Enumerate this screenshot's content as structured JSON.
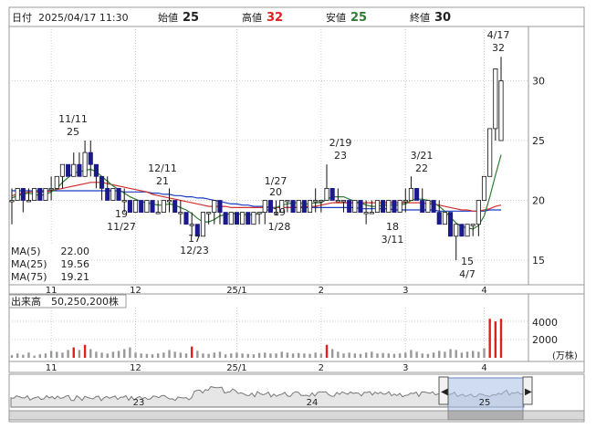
{
  "header": {
    "date_label": "日付",
    "datetime": "2025/04/17 11:30",
    "open_label": "始値",
    "open": "25",
    "high_label": "高値",
    "high": "32",
    "low_label": "安値",
    "low": "25",
    "close_label": "終値",
    "close": "30"
  },
  "legend": {
    "ma5_label": "MA(5)",
    "ma5_value": "22.00",
    "ma5_color": "#2e7d32",
    "ma25_label": "MA(25)",
    "ma25_value": "19.56",
    "ma25_color": "#d32f2f",
    "ma75_label": "MA(75)",
    "ma75_value": "19.21",
    "ma75_color": "#1a3dc8"
  },
  "volume": {
    "label": "出来高",
    "value": "50,250,200株",
    "ticks": [
      "4000",
      "2000"
    ],
    "unit": "(万株)"
  },
  "xaxis_months": [
    "11",
    "12",
    "25/1",
    "2",
    "3",
    "4"
  ],
  "navigator": {
    "year_labels": [
      "23",
      "24",
      "25"
    ]
  },
  "colors": {
    "up": "#ffffff",
    "down": "#1a1a8c",
    "vol_up": "#e02020",
    "vol_down": "#999999"
  },
  "chart_data": {
    "type": "candlestick",
    "y_ticks": [
      15,
      20,
      25,
      30
    ],
    "ylim": [
      12,
      35
    ],
    "annotations": [
      {
        "date": "11/11",
        "value": "25"
      },
      {
        "date": "11/27",
        "value": "19"
      },
      {
        "date": "12/11",
        "value": "21"
      },
      {
        "date": "12/23",
        "value": "17"
      },
      {
        "date": "1/27",
        "value": "20"
      },
      {
        "date": "1/28",
        "value": "19"
      },
      {
        "date": "2/19",
        "value": "23"
      },
      {
        "date": "3/11",
        "value": "18"
      },
      {
        "date": "3/21",
        "value": "22"
      },
      {
        "date": "4/7",
        "value": "15"
      },
      {
        "date": "4/17",
        "value": "32"
      }
    ],
    "candles": [
      [
        20,
        21,
        18,
        20
      ],
      [
        20,
        21,
        20,
        21
      ],
      [
        21,
        21,
        19,
        20
      ],
      [
        20,
        21,
        20,
        20
      ],
      [
        20,
        21,
        20,
        21
      ],
      [
        21,
        21,
        20,
        20
      ],
      [
        20,
        21,
        20,
        21
      ],
      [
        21,
        22,
        20,
        21
      ],
      [
        21,
        22,
        21,
        22
      ],
      [
        22,
        23,
        21,
        23
      ],
      [
        23,
        23,
        22,
        22
      ],
      [
        22,
        24,
        22,
        23
      ],
      [
        23,
        24,
        22,
        22
      ],
      [
        22,
        25,
        22,
        24
      ],
      [
        24,
        25,
        22,
        23
      ],
      [
        23,
        23,
        21,
        22
      ],
      [
        22,
        22,
        20,
        21
      ],
      [
        21,
        22,
        20,
        20
      ],
      [
        20,
        21,
        20,
        21
      ],
      [
        21,
        21,
        20,
        20
      ],
      [
        20,
        21,
        19,
        20
      ],
      [
        20,
        20,
        19,
        19
      ],
      [
        19,
        20,
        19,
        20
      ],
      [
        20,
        20,
        19,
        19
      ],
      [
        19,
        20,
        19,
        20
      ],
      [
        20,
        20,
        19,
        19
      ],
      [
        19,
        20,
        19,
        19
      ],
      [
        19,
        20,
        19,
        20
      ],
      [
        20,
        21,
        19,
        20
      ],
      [
        20,
        20,
        19,
        19
      ],
      [
        19,
        20,
        18,
        19
      ],
      [
        19,
        19,
        18,
        18
      ],
      [
        18,
        19,
        17,
        18
      ],
      [
        18,
        18,
        17,
        17
      ],
      [
        17,
        19,
        17,
        19
      ],
      [
        19,
        19,
        18,
        19
      ],
      [
        19,
        20,
        18,
        20
      ],
      [
        20,
        20,
        18,
        19
      ],
      [
        19,
        19,
        18,
        18
      ],
      [
        18,
        19,
        18,
        19
      ],
      [
        19,
        19,
        18,
        18
      ],
      [
        18,
        19,
        18,
        19
      ],
      [
        19,
        19,
        18,
        18
      ],
      [
        18,
        19,
        18,
        19
      ],
      [
        19,
        19,
        18,
        19
      ],
      [
        19,
        20,
        18,
        20
      ],
      [
        20,
        20,
        19,
        19
      ],
      [
        19,
        20,
        19,
        19
      ],
      [
        19,
        20,
        19,
        20
      ],
      [
        20,
        20,
        19,
        20
      ],
      [
        20,
        20,
        19,
        19
      ],
      [
        19,
        20,
        19,
        20
      ],
      [
        20,
        20,
        19,
        19
      ],
      [
        19,
        20,
        19,
        20
      ],
      [
        20,
        21,
        19,
        20
      ],
      [
        20,
        20,
        19,
        20
      ],
      [
        20,
        23,
        20,
        21
      ],
      [
        21,
        21,
        20,
        20
      ],
      [
        20,
        21,
        20,
        20
      ],
      [
        20,
        20,
        19,
        20
      ],
      [
        20,
        20,
        19,
        19
      ],
      [
        19,
        20,
        19,
        20
      ],
      [
        20,
        20,
        19,
        19
      ],
      [
        19,
        20,
        18,
        19
      ],
      [
        19,
        20,
        19,
        19
      ],
      [
        19,
        20,
        19,
        20
      ],
      [
        20,
        20,
        19,
        19
      ],
      [
        19,
        20,
        19,
        20
      ],
      [
        20,
        20,
        19,
        19
      ],
      [
        19,
        20,
        19,
        20
      ],
      [
        20,
        21,
        19,
        20
      ],
      [
        20,
        22,
        20,
        21
      ],
      [
        21,
        21,
        20,
        20
      ],
      [
        20,
        21,
        19,
        19
      ],
      [
        19,
        20,
        19,
        20
      ],
      [
        20,
        20,
        19,
        19
      ],
      [
        19,
        20,
        18,
        18
      ],
      [
        18,
        19,
        18,
        19
      ],
      [
        19,
        19,
        17,
        17
      ],
      [
        17,
        18,
        15,
        18
      ],
      [
        18,
        18,
        17,
        17
      ],
      [
        17,
        18,
        17,
        18
      ],
      [
        18,
        18,
        17,
        18
      ],
      [
        18,
        20,
        17,
        20
      ],
      [
        20,
        22,
        20,
        22
      ],
      [
        22,
        26,
        22,
        26
      ],
      [
        26,
        31,
        25,
        31
      ],
      [
        25,
        32,
        25,
        30
      ]
    ],
    "volumes": [
      300,
      500,
      350,
      600,
      250,
      400,
      500,
      800,
      700,
      600,
      900,
      1200,
      900,
      1500,
      1000,
      700,
      600,
      500,
      700,
      800,
      1000,
      1200,
      600,
      500,
      450,
      400,
      500,
      600,
      900,
      700,
      600,
      500,
      1300,
      800,
      500,
      450,
      600,
      700,
      400,
      500,
      600,
      500,
      450,
      400,
      550,
      600,
      500,
      500,
      700,
      600,
      500,
      550,
      500,
      450,
      600,
      500,
      1500,
      1000,
      700,
      500,
      600,
      500,
      450,
      600,
      700,
      500,
      550,
      500,
      450,
      500,
      600,
      900,
      700,
      500,
      450,
      600,
      800,
      700,
      1000,
      900,
      600,
      700,
      800,
      700,
      1100,
      4500,
      4200,
      4500
    ],
    "ma5": [
      20.2,
      20.4,
      20.5,
      20.6,
      20.5,
      20.4,
      20.5,
      20.7,
      21,
      21.5,
      21.9,
      22.3,
      22.4,
      22.5,
      22.6,
      22.4,
      22,
      21.6,
      21.2,
      20.9,
      20.6,
      20.3,
      20.1,
      19.9,
      19.8,
      19.7,
      19.6,
      19.6,
      19.7,
      19.6,
      19.4,
      19.2,
      18.9,
      18.5,
      18.2,
      18.2,
      18.4,
      18.7,
      18.8,
      18.9,
      18.9,
      18.8,
      18.8,
      18.8,
      18.9,
      19.1,
      19.3,
      19.4,
      19.6,
      19.7,
      19.8,
      19.8,
      19.7,
      19.7,
      19.8,
      19.8,
      20.1,
      20.3,
      20.3,
      20.3,
      20.1,
      19.9,
      19.8,
      19.6,
      19.5,
      19.5,
      19.6,
      19.6,
      19.6,
      19.6,
      19.7,
      20,
      20.1,
      20.1,
      20,
      19.8,
      19.5,
      19.1,
      18.6,
      18.1,
      17.8,
      17.7,
      17.6,
      17.9,
      18.7,
      20.3,
      22.1,
      23.8
    ],
    "ma25": [
      20.4,
      20.5,
      20.6,
      20.7,
      20.7,
      20.7,
      20.7,
      20.8,
      20.9,
      21,
      21.1,
      21.2,
      21.3,
      21.4,
      21.5,
      21.5,
      21.5,
      21.4,
      21.3,
      21.2,
      21.1,
      21,
      20.9,
      20.8,
      20.7,
      20.5,
      20.4,
      20.3,
      20.2,
      20.1,
      20,
      19.9,
      19.8,
      19.7,
      19.6,
      19.5,
      19.5,
      19.5,
      19.5,
      19.4,
      19.4,
      19.4,
      19.4,
      19.4,
      19.4,
      19.4,
      19.4,
      19.4,
      19.4,
      19.4,
      19.4,
      19.4,
      19.5,
      19.5,
      19.5,
      19.6,
      19.7,
      19.8,
      19.8,
      19.8,
      19.8,
      19.8,
      19.8,
      19.8,
      19.8,
      19.8,
      19.8,
      19.8,
      19.8,
      19.8,
      19.8,
      19.8,
      19.8,
      19.8,
      19.7,
      19.7,
      19.6,
      19.5,
      19.4,
      19.3,
      19.2,
      19.2,
      19.1,
      19.1,
      19.2,
      19.3,
      19.5,
      19.6
    ],
    "ma75": [
      20.8,
      20.8,
      20.8,
      20.8,
      20.8,
      20.8,
      20.8,
      20.8,
      20.8,
      20.8,
      20.8,
      20.8,
      20.8,
      20.8,
      20.8,
      20.8,
      20.8,
      20.8,
      20.8,
      20.8,
      20.7,
      20.7,
      20.7,
      20.7,
      20.7,
      20.6,
      20.6,
      20.5,
      20.5,
      20.4,
      20.4,
      20.3,
      20.3,
      20.2,
      20.2,
      20.1,
      20,
      19.9,
      19.8,
      19.7,
      19.7,
      19.6,
      19.6,
      19.5,
      19.5,
      19.5,
      19.4,
      19.4,
      19.4,
      19.4,
      19.4,
      19.4,
      19.4,
      19.4,
      19.4,
      19.4,
      19.4,
      19.4,
      19.4,
      19.4,
      19.4,
      19.4,
      19.3,
      19.3,
      19.3,
      19.3,
      19.3,
      19.3,
      19.2,
      19.2,
      19.2,
      19.2,
      19.2,
      19.2,
      19.2,
      19.2,
      19.1,
      19.1,
      19.1,
      19.1,
      19.1,
      19.1,
      19.1,
      19.1,
      19.1,
      19.2,
      19.2,
      19.2
    ]
  }
}
